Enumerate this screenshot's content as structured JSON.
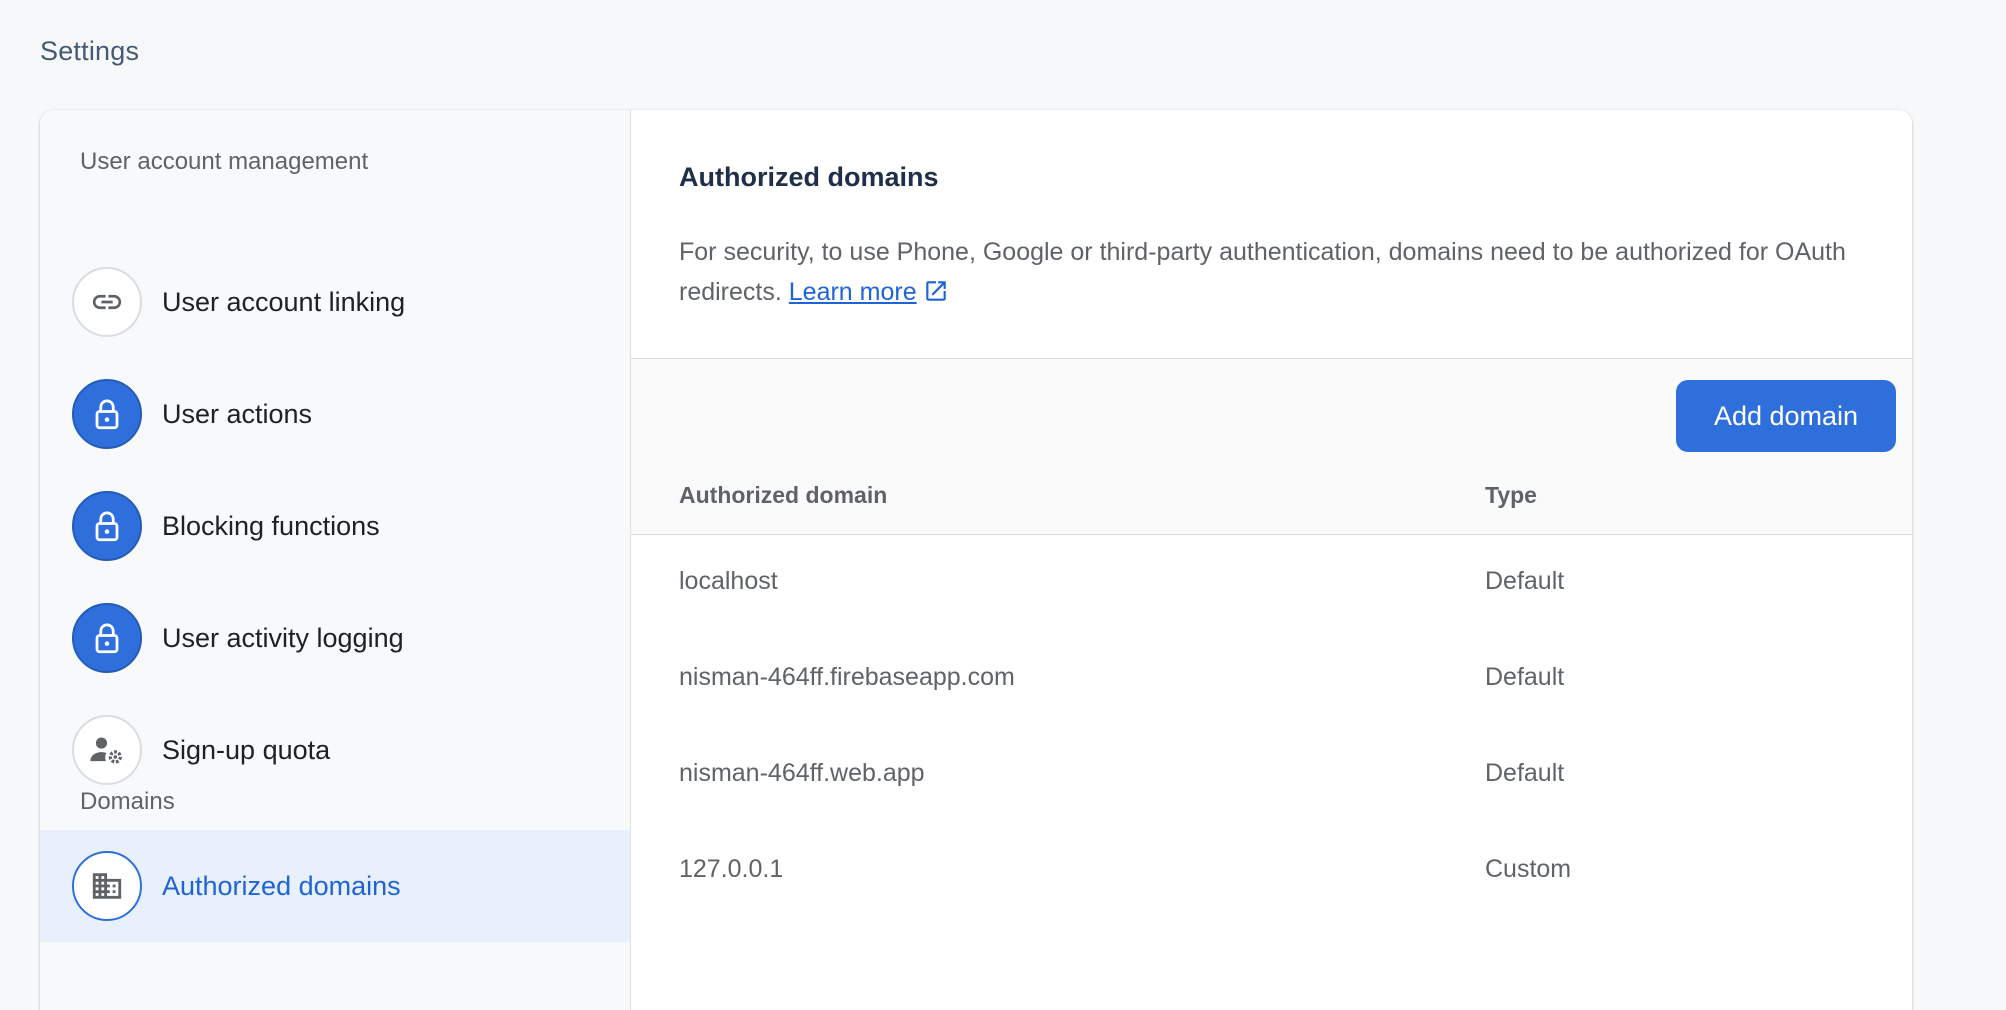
{
  "page": {
    "title": "Settings"
  },
  "sidebar": {
    "sections": [
      {
        "label": "User account management",
        "items": [
          {
            "label": "User account linking",
            "icon": "link-icon"
          },
          {
            "label": "User actions",
            "icon": "lock-icon"
          },
          {
            "label": "Blocking functions",
            "icon": "lock-icon"
          },
          {
            "label": "User activity logging",
            "icon": "lock-icon"
          },
          {
            "label": "Sign-up quota",
            "icon": "person-gear-icon"
          }
        ]
      },
      {
        "label": "Domains",
        "items": [
          {
            "label": "Authorized domains",
            "icon": "building-icon",
            "selected": true
          }
        ]
      }
    ]
  },
  "main": {
    "title": "Authorized domains",
    "description": "For security, to use Phone, Google or third-party authentication, domains need to be authorized for OAuth redirects.",
    "learn_more": "Learn more",
    "add_button": "Add domain",
    "table": {
      "columns": [
        "Authorized domain",
        "Type"
      ],
      "rows": [
        {
          "domain": "localhost",
          "type": "Default"
        },
        {
          "domain": "nisman-464ff.firebaseapp.com",
          "type": "Default"
        },
        {
          "domain": "nisman-464ff.web.app",
          "type": "Default"
        },
        {
          "domain": "127.0.0.1",
          "type": "Custom"
        }
      ]
    }
  },
  "colors": {
    "accent": "#2f6fdc",
    "selected_bg": "#e8f0fe",
    "selected_text": "#1f64d6"
  }
}
